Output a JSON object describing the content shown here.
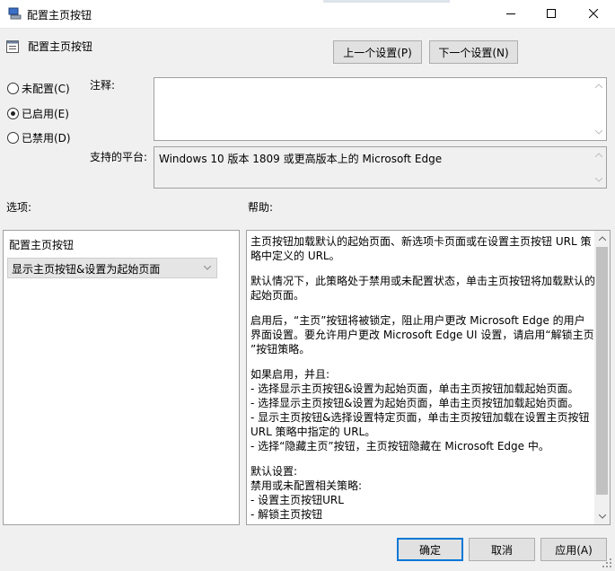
{
  "window": {
    "title": "配置主页按钮",
    "icons": [
      "policy-window-icon",
      "minimize-icon",
      "maximize-icon",
      "close-icon"
    ]
  },
  "header": {
    "title": "配置主页按钮",
    "prev_label": "上一个设置(P)",
    "next_label": "下一个设置(N)"
  },
  "state": {
    "options": [
      {
        "label": "未配置(C)",
        "checked": false
      },
      {
        "label": "已启用(E)",
        "checked": true
      },
      {
        "label": "已禁用(D)",
        "checked": false
      }
    ]
  },
  "comment": {
    "label": "注释:",
    "value": ""
  },
  "platform": {
    "label": "支持的平台:",
    "value": "Windows 10 版本 1809 或更高版本上的 Microsoft Edge"
  },
  "options_panel": {
    "label": "选项:",
    "setting_label": "配置主页按钮",
    "selected": "显示主页按钮&设置为起始页面"
  },
  "help": {
    "label": "帮助:",
    "p1": [
      "主页按钮加载默认的起始页面、新选项卡页面或在设置主页按钮 URL 策",
      "略中定义的 URL。"
    ],
    "p2": [
      "默认情况下，此策略处于禁用或未配置状态，单击主页按钮将加载默认的",
      "起始页面。"
    ],
    "p3": [
      "启用后，“主页”按钮将被锁定，阻止用户更改 Microsoft Edge 的用户",
      "界面设置。要允许用户更改 Microsoft Edge UI 设置，请启用“解锁主页",
      "”按钮策略。"
    ],
    "p4": [
      "如果启用，并且:",
      "- 选择显示主页按钮&设置为起始页面，单击主页按钮加载起始页面。",
      "- 选择显示主页按钮&设置为起始页面，单击主页按钮加载起始页面。",
      "- 显示主页按钮&选择设置特定页面，单击主页按钮加载在设置主页按钮",
      "URL 策略中指定的 URL。",
      "- 选择“隐藏主页”按钮，主页按钮隐藏在 Microsoft Edge 中。"
    ],
    "p5": [
      "默认设置:",
      "禁用或未配置相关策略:",
      "- 设置主页按钮URL",
      "- 解锁主页按钮"
    ]
  },
  "footer": {
    "ok_label": "确定",
    "cancel_label": "取消",
    "apply_label": "应用(A)"
  }
}
